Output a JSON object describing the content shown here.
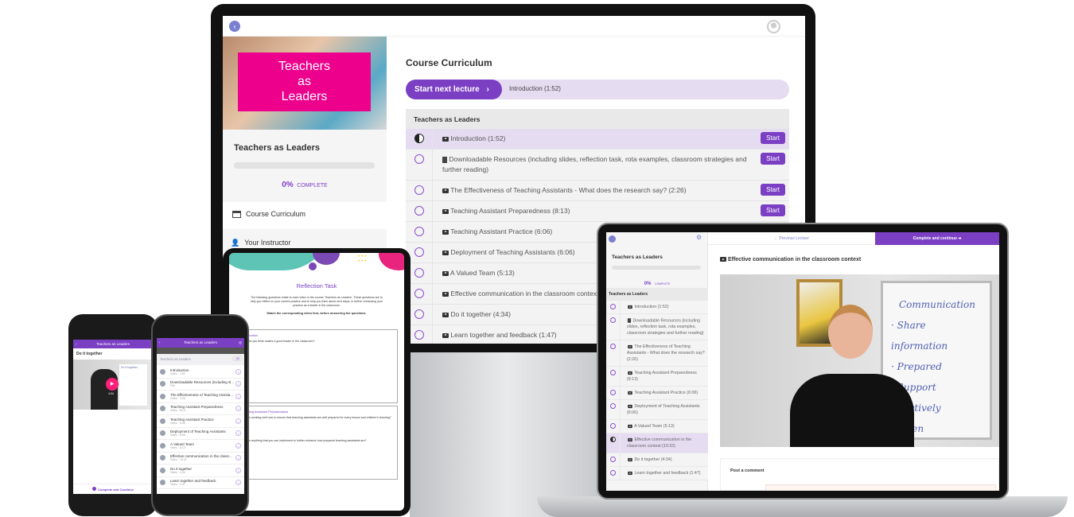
{
  "colors": {
    "accent": "#7b3fc4",
    "brand_pink": "#ec008c",
    "highlight": "#e6dcf2"
  },
  "course_title": "Teachers as Leaders",
  "monitor": {
    "cover_title_lines": [
      "Teachers",
      "as",
      "Leaders"
    ],
    "progress_percent": "0%",
    "progress_label": "COMPLETE",
    "progress_value": 0,
    "nav": [
      {
        "label": "Course Curriculum",
        "icon": "curriculum-icon"
      },
      {
        "label": "Your Instructor",
        "icon": "user-icon"
      }
    ],
    "heading": "Course Curriculum",
    "start_next_label": "Start next lecture",
    "next_lecture": "Introduction (1:52)",
    "section_title": "Teachers as Leaders",
    "start_label": "Start",
    "lectures": [
      {
        "title": "Introduction (1:52)",
        "type": "video",
        "status": "in-progress"
      },
      {
        "title": "Downloadable Resources (including slides, reflection task, rota examples, classroom strategies and further reading)",
        "type": "file",
        "status": "incomplete"
      },
      {
        "title": "The Effectiveness of Teaching Assistants - What does the research say? (2:26)",
        "type": "video",
        "status": "incomplete"
      },
      {
        "title": "Teaching Assistant Preparedness (8:13)",
        "type": "video",
        "status": "incomplete"
      },
      {
        "title": "Teaching Assistant Practice (6:06)",
        "type": "video",
        "status": "incomplete"
      },
      {
        "title": "Deployment of Teaching Assistants (6:06)",
        "type": "video",
        "status": "incomplete"
      },
      {
        "title": "A Valued Team (5:13)",
        "type": "video",
        "status": "incomplete"
      },
      {
        "title": "Effective communication in the classroom context (10:32)",
        "type": "video",
        "status": "incomplete"
      },
      {
        "title": "Do it together (4:34)",
        "type": "video",
        "status": "incomplete"
      },
      {
        "title": "Learn together and feedback (1:47)",
        "type": "video",
        "status": "incomplete"
      }
    ]
  },
  "laptop": {
    "prev_label": "Previous Lecture",
    "complete_label": "Complete and continue",
    "progress_percent": "0%",
    "progress_label": "COMPLETE",
    "section_title": "Teachers as Leaders",
    "lecture_title": "Effective communication in the classroom context",
    "whiteboard": [
      "Communication",
      "· Share information",
      "· Prepared",
      "· Support effectively",
      "· listen"
    ],
    "comment_label": "Post a comment",
    "current_index": 7
  },
  "tablet": {
    "title": "Reflection Task",
    "intro": "The following questions relate to each video in the course 'Teachers as Leaders'. These questions are to help you reflect on your current practice and to help you think about next steps, in further enhancing your practice as a leader in the classroom.",
    "instruction": "Watch the corresponding video first, before answering the questions.",
    "sections": [
      {
        "title": "Introduction",
        "questions": [
          "What do you think makes a good leader in the classroom?"
        ]
      },
      {
        "title": "Teaching Assistant Preparedness",
        "questions": [
          "What is working well now to ensure that teaching assistants are well prepared for every lesson and children's learning?",
          "Is there anything that you can implement to further enhance how prepared teaching assistants are?"
        ]
      }
    ]
  },
  "phone1": {
    "header": "Teachers as Leaders",
    "lecture": "Do it together",
    "duration": "4:34",
    "whiteboard": "Do it together",
    "complete_label": "Complete and Continue"
  },
  "phone2": {
    "header": "Teachers as Leaders",
    "section": "Teachers as Leaders",
    "all_label": "All",
    "items": [
      {
        "title": "Introduction",
        "meta": "Video · 1:52"
      },
      {
        "title": "Downloadable Resources (including sl...",
        "meta": "File"
      },
      {
        "title": "The Effectiveness of Teaching Assista...",
        "meta": "Video · 2:26"
      },
      {
        "title": "Teaching Assistant Preparedness",
        "meta": "Video · 8:13"
      },
      {
        "title": "Teaching Assistant Practice",
        "meta": "Video · 6:06"
      },
      {
        "title": "Deployment of Teaching Assistants",
        "meta": "Video · 6:06"
      },
      {
        "title": "A Valued Team",
        "meta": "Video · 5:13"
      },
      {
        "title": "Effective communication in the classr...",
        "meta": "Video · 10:32"
      },
      {
        "title": "Do it together",
        "meta": "Video · 4:34"
      },
      {
        "title": "Learn together and feedback",
        "meta": "Video · 1:47"
      }
    ]
  }
}
